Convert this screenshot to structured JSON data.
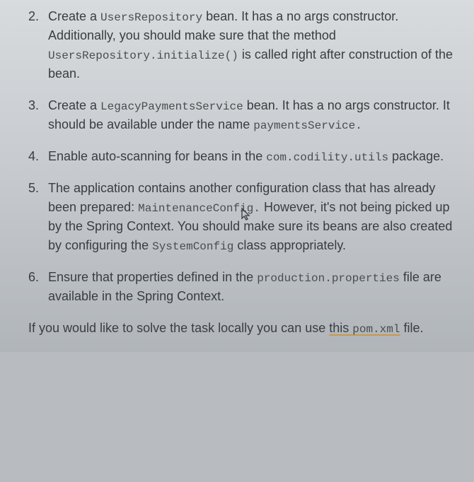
{
  "items": [
    {
      "num": "2.",
      "t1": "Create a ",
      "c1": "UsersRepository",
      "t2": " bean. It has a no args constructor. Additionally, you should make sure that the method ",
      "c2": "UsersRepository.initialize()",
      "t3": " is called right after construction of the bean."
    },
    {
      "num": "3.",
      "t1": "Create a ",
      "c1": "LegacyPaymentsService",
      "t2": " bean. It has a no args constructor. It should be available under the name ",
      "c2": "paymentsService.",
      "t3": ""
    },
    {
      "num": "4.",
      "t1": "Enable auto-scanning for beans in the ",
      "c1": "com.codility.utils",
      "t2": " package.",
      "c2": "",
      "t3": ""
    },
    {
      "num": "5.",
      "t1": "The application contains another configuration class that has already been prepared: ",
      "c1": "MaintenanceConfig.",
      "t2": " However, it's not being picked up by the Spring Context. You should make sure its beans are also created by configuring the ",
      "c2": "SystemConfig",
      "t3": " class appropriately."
    },
    {
      "num": "6.",
      "t1": "Ensure that properties defined in the ",
      "c1": "production.properties",
      "t2": " file are available in the Spring Context.",
      "c2": "",
      "t3": ""
    }
  ],
  "footer": {
    "t1": "If you would like to solve the task locally you can use ",
    "link": "this ",
    "c1": "pom.xml",
    "t2": " file."
  }
}
